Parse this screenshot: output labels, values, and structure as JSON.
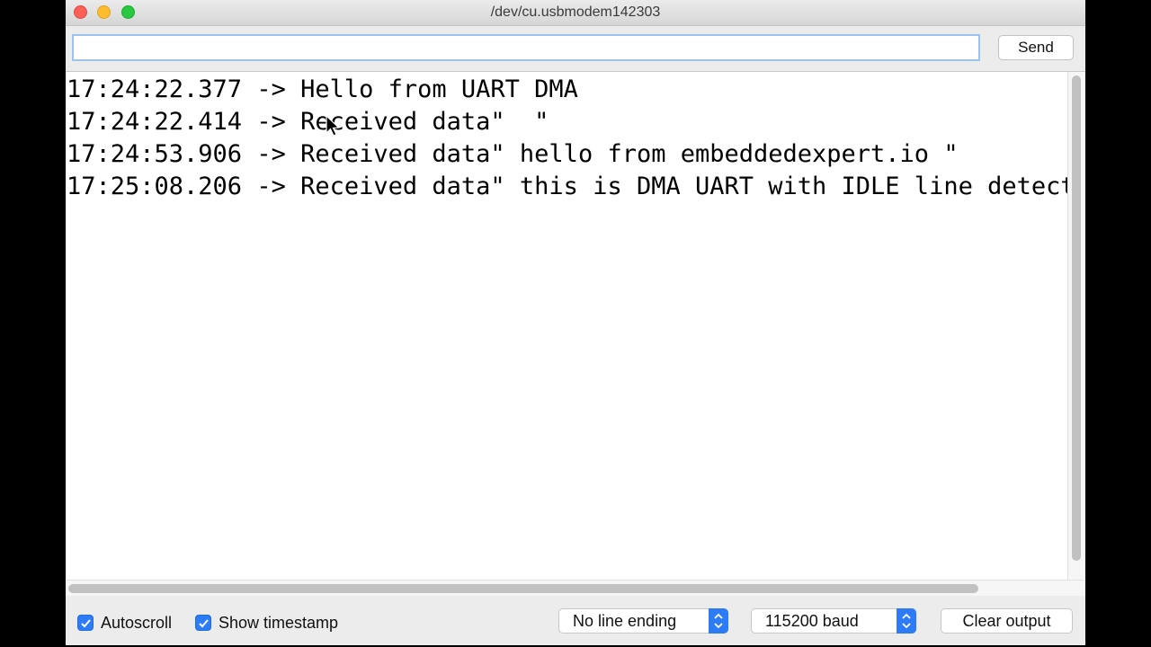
{
  "window": {
    "title": "/dev/cu.usbmodem142303"
  },
  "input": {
    "value": "",
    "send_label": "Send"
  },
  "output": {
    "lines": [
      "17:24:22.377 -> Hello from UART DMA",
      "17:24:22.414 -> Received data\"  \"",
      "17:24:53.906 -> Received data\" hello from embeddedexpert.io \"",
      "17:25:08.206 -> Received data\" this is DMA UART with IDLE line detect"
    ]
  },
  "bottom": {
    "autoscroll": {
      "label": "Autoscroll",
      "checked": true
    },
    "timestamp": {
      "label": "Show timestamp",
      "checked": true
    },
    "line_ending": {
      "selected": "No line ending"
    },
    "baud": {
      "selected": "115200 baud"
    },
    "clear_label": "Clear output"
  },
  "colors": {
    "accent": "#2d7cf6",
    "close": "#fc5f57",
    "minimize": "#fdbc2e",
    "maximize": "#28c840"
  }
}
